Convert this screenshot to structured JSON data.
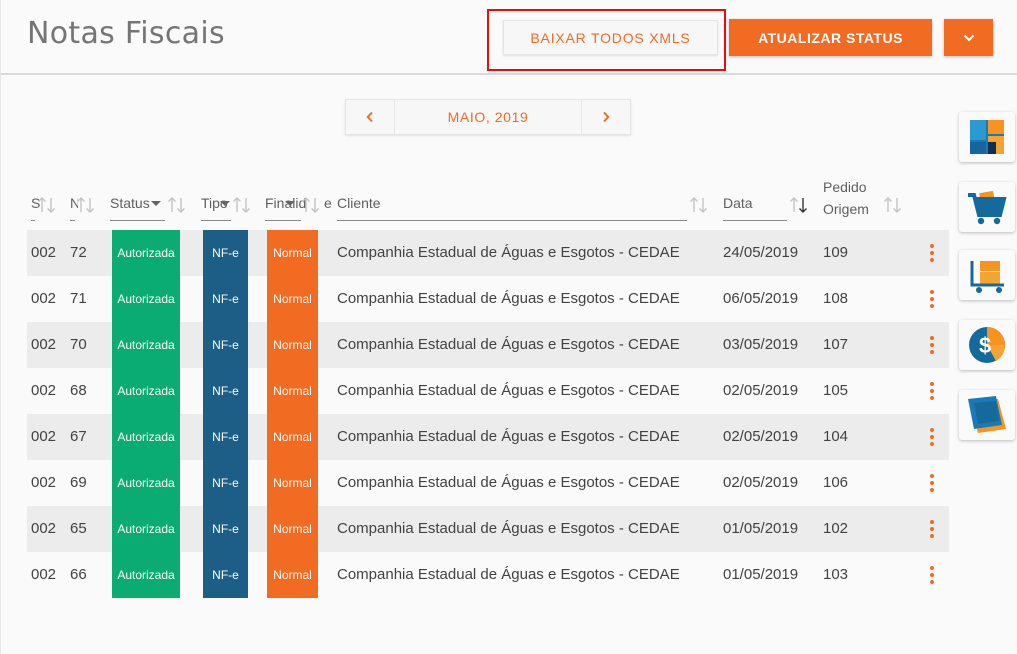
{
  "header": {
    "title": "Notas Fiscais",
    "download_xml_label": "BAIXAR TODOS XMLS",
    "update_status_label": "ATUALIZAR STATUS"
  },
  "month_nav": {
    "label": "MAIO, 2019"
  },
  "columns": [
    {
      "label": "S"
    },
    {
      "label": "N"
    },
    {
      "label": "Status"
    },
    {
      "label": "Tipo"
    },
    {
      "label": "Finalid"
    },
    {
      "label": "e"
    },
    {
      "label": "Cliente"
    },
    {
      "label": "Data"
    },
    {
      "label": "Pedido"
    },
    {
      "label": "Origem"
    }
  ],
  "rows": [
    {
      "serie": "002",
      "numero": "72",
      "status": "Autorizada",
      "tipo": "NF-e",
      "finalidade": "Normal",
      "cliente": "Companhia Estadual de Águas e Esgotos - CEDAE",
      "data": "24/05/2019",
      "pedido": "109"
    },
    {
      "serie": "002",
      "numero": "71",
      "status": "Autorizada",
      "tipo": "NF-e",
      "finalidade": "Normal",
      "cliente": "Companhia Estadual de Águas e Esgotos - CEDAE",
      "data": "06/05/2019",
      "pedido": "108"
    },
    {
      "serie": "002",
      "numero": "70",
      "status": "Autorizada",
      "tipo": "NF-e",
      "finalidade": "Normal",
      "cliente": "Companhia Estadual de Águas e Esgotos - CEDAE",
      "data": "03/05/2019",
      "pedido": "107"
    },
    {
      "serie": "002",
      "numero": "68",
      "status": "Autorizada",
      "tipo": "NF-e",
      "finalidade": "Normal",
      "cliente": "Companhia Estadual de Águas e Esgotos - CEDAE",
      "data": "02/05/2019",
      "pedido": "105"
    },
    {
      "serie": "002",
      "numero": "67",
      "status": "Autorizada",
      "tipo": "NF-e",
      "finalidade": "Normal",
      "cliente": "Companhia Estadual de Águas e Esgotos - CEDAE",
      "data": "02/05/2019",
      "pedido": "104"
    },
    {
      "serie": "002",
      "numero": "69",
      "status": "Autorizada",
      "tipo": "NF-e",
      "finalidade": "Normal",
      "cliente": "Companhia Estadual de Águas e Esgotos - CEDAE",
      "data": "02/05/2019",
      "pedido": "106"
    },
    {
      "serie": "002",
      "numero": "65",
      "status": "Autorizada",
      "tipo": "NF-e",
      "finalidade": "Normal",
      "cliente": "Companhia Estadual de Águas e Esgotos - CEDAE",
      "data": "01/05/2019",
      "pedido": "102"
    },
    {
      "serie": "002",
      "numero": "66",
      "status": "Autorizada",
      "tipo": "NF-e",
      "finalidade": "Normal",
      "cliente": "Companhia Estadual de Águas e Esgotos - CEDAE",
      "data": "01/05/2019",
      "pedido": "103"
    }
  ],
  "side_apps": [
    {
      "icon": "dashboard-app-icon"
    },
    {
      "icon": "shopping-cart-app-icon"
    },
    {
      "icon": "cart-boxes-app-icon"
    },
    {
      "icon": "finance-dollar-app-icon"
    },
    {
      "icon": "layers-app-icon"
    }
  ],
  "colors": {
    "accent": "#f26b22",
    "status_green": "#0bab74",
    "tipo_blue": "#1c5e86",
    "highlight_red": "#e01010"
  }
}
